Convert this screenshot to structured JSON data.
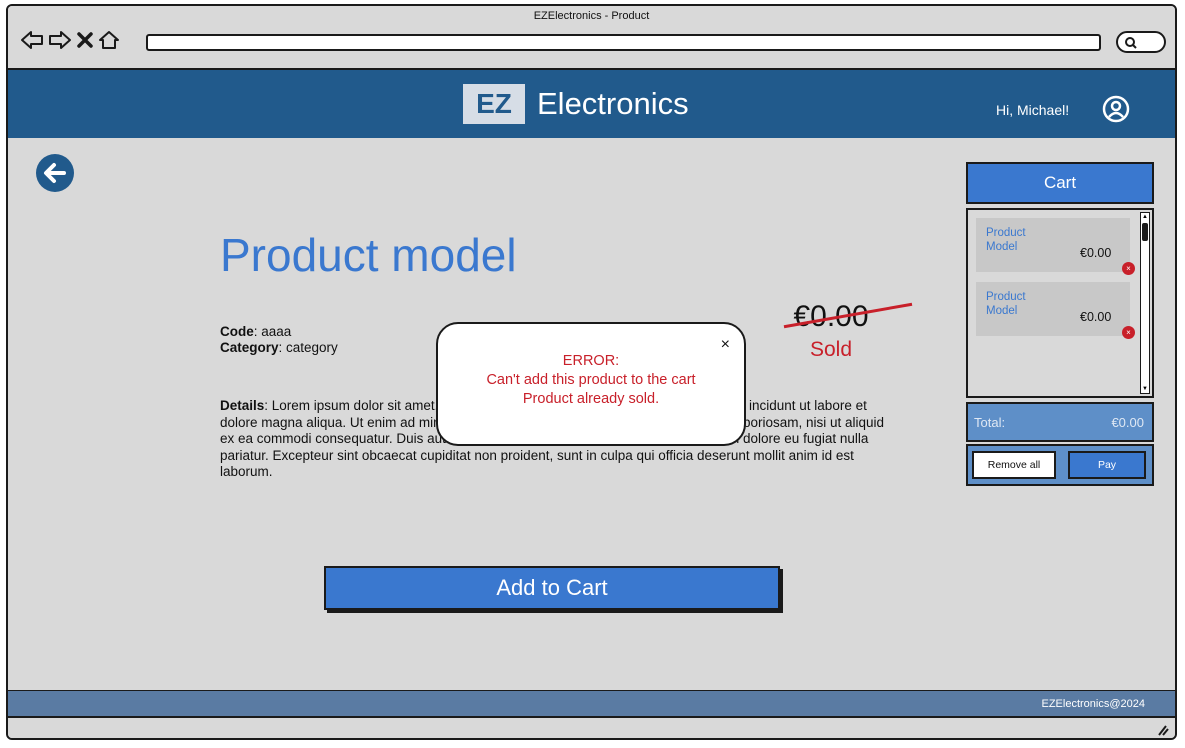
{
  "window": {
    "title": "EZElectronics - Product"
  },
  "header": {
    "logo_box": "EZ",
    "logo_text": "Electronics",
    "greeting": "Hi, Michael!"
  },
  "product": {
    "title": "Product model",
    "code_label": "Code",
    "code_value": ": aaaa",
    "category_label": "Category",
    "category_value": ": category",
    "details_label": "Details",
    "details_value": ": Lorem ipsum dolor sit amet, consectetur adipiscing elit, sed do eiusmod tempor incidunt ut labore et dolore magna aliqua. Ut enim ad minim veniam, quis nostrum exercitationem ullamco laboriosam, nisi ut aliquid ex ea commodi consequatur. Duis aute irure reprehenderit in voluptate velit esse cillum dolore eu fugiat nulla pariatur. Excepteur sint obcaecat cupiditat non proident, sunt in culpa qui officia deserunt mollit anim id est laborum.",
    "price": "€0.00",
    "status": "Sold",
    "add_button": "Add to Cart"
  },
  "cart": {
    "title": "Cart",
    "items": [
      {
        "name": "Product Model",
        "price": "€0.00",
        "remove": "×"
      },
      {
        "name": "Product Model",
        "price": "€0.00",
        "remove": "×"
      }
    ],
    "total_label": "Total:",
    "total_value": "€0.00",
    "remove_all": "Remove all",
    "pay": "Pay"
  },
  "modal": {
    "close": "×",
    "line1": "ERROR:",
    "line2": "Can't add this product to the cart",
    "line3": "Product already sold."
  },
  "footer": {
    "text": "EZElectronics@2024"
  },
  "colors": {
    "header": "#215a8c",
    "accent": "#3a78cf",
    "error": "#c8202a",
    "footer": "#5a7ba3"
  }
}
